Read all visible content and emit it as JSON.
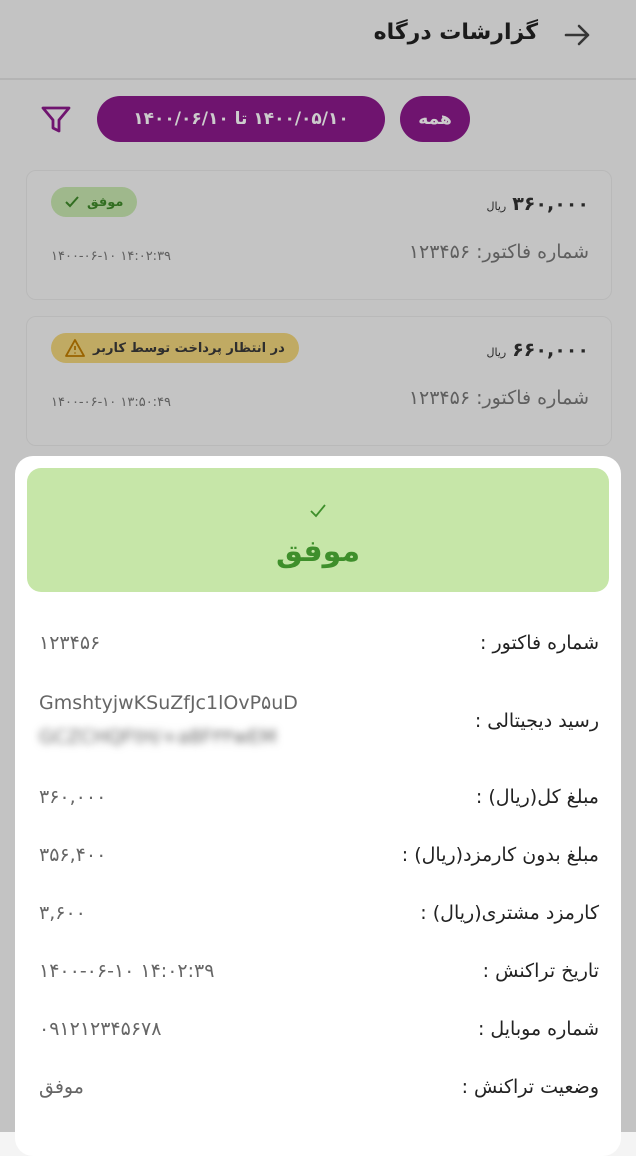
{
  "header": {
    "title": "گزارشات درگاه"
  },
  "filters": {
    "all_label": "همه",
    "date_range_label": "۱۴۰۰/۰۵/۱۰ تا ۱۴۰۰/۰۶/۱۰"
  },
  "transactions": [
    {
      "amount": "۳۶۰,۰۰۰",
      "currency": "ریال",
      "status": "موفق",
      "invoice": "شماره فاکتور: ۱۲۳۴۵۶",
      "datetime": "۱۴۰۰-۰۶-۱۰ ۱۴:۰۲:۳۹"
    },
    {
      "amount": "۶۶۰,۰۰۰",
      "currency": "ریال",
      "status": "در انتظار پرداخت توسط کاربر",
      "invoice": "شماره فاکتور: ۱۲۳۴۵۶",
      "datetime": "۱۴۰۰-۰۶-۱۰ ۱۳:۵۰:۴۹"
    }
  ],
  "detail": {
    "status_title": "موفق",
    "rows": [
      {
        "label": "شماره فاکتور :",
        "value": "۱۲۳۴۵۶"
      },
      {
        "label": "رسید دیجیتالی :",
        "value": "GmshtyjwKSuZfJc1lOvP۵uD",
        "value2": "GCZCHQFtH/+a8F۳۳wEM"
      },
      {
        "label": "مبلغ کل(ریال) :",
        "value": "۳۶۰,۰۰۰"
      },
      {
        "label": "مبلغ بدون کارمزد(ریال) :",
        "value": "۳۵۶,۴۰۰"
      },
      {
        "label": "کارمزد مشتری(ریال) :",
        "value": "۳,۶۰۰"
      },
      {
        "label": "تاریخ تراکنش :",
        "value": "۱۴۰۰-۰۶-۱۰ ۱۴:۰۲:۳۹"
      },
      {
        "label": "شماره موبایل :",
        "value": "۰۹۱۲۱۲۳۴۵۶۷۸"
      },
      {
        "label": "وضعیت تراکنش :",
        "value": "موفق"
      }
    ]
  },
  "colors": {
    "accent": "#8b1a8b",
    "success_bg": "#c6e6a8",
    "success_text": "#3e8f2b",
    "warning_bg": "#f1d57c"
  }
}
